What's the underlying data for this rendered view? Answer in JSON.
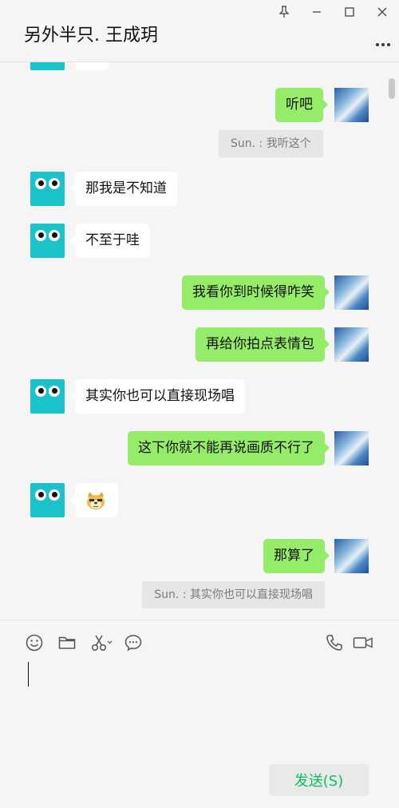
{
  "window": {
    "title": "另外半只. 王成玥",
    "controls": [
      "pin-icon",
      "minimize-icon",
      "maximize-icon",
      "close-icon"
    ]
  },
  "header": {
    "more_icon": "more-dots-icon"
  },
  "messages": [
    {
      "id": "m0",
      "side": "in",
      "text": "",
      "note": "partially scrolled off"
    },
    {
      "id": "m1",
      "side": "out",
      "text": "听吧"
    },
    {
      "id": "q1",
      "type": "quote",
      "text": "Sun. : 我听这个"
    },
    {
      "id": "m2",
      "side": "in",
      "text": "那我是不知道"
    },
    {
      "id": "m3",
      "side": "in",
      "text": "不至于哇"
    },
    {
      "id": "m4",
      "side": "out",
      "text": "我看你到时候得咋笑"
    },
    {
      "id": "m5",
      "side": "out",
      "text": "再给你拍点表情包"
    },
    {
      "id": "m6",
      "side": "in",
      "text": "其实你也可以直接现场唱"
    },
    {
      "id": "m7",
      "side": "out",
      "text": "这下你就不能再说画质不行了"
    },
    {
      "id": "m8",
      "side": "in",
      "type": "emoji",
      "emoji": "doge-emoji"
    },
    {
      "id": "m9",
      "side": "out",
      "text": "那算了"
    },
    {
      "id": "q2",
      "type": "quote",
      "text": "Sun. : 其实你也可以直接现场唱"
    }
  ],
  "toolbar": {
    "left": [
      "emoji-icon",
      "folder-icon",
      "scissors-icon",
      "chat-history-icon"
    ],
    "right": [
      "phone-icon",
      "video-call-icon"
    ]
  },
  "composer": {
    "value": ""
  },
  "send_button": {
    "label": "发送(S)"
  },
  "colors": {
    "background": "#f5f5f5",
    "incoming_bubble": "#ffffff",
    "outgoing_bubble": "#95ec69",
    "quote_bg": "#e6e6e6",
    "send_text": "#07c160",
    "avatar_teal": "#1ac2c9"
  }
}
